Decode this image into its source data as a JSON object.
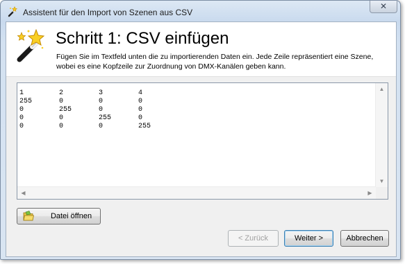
{
  "window": {
    "title": "Assistent für den Import von Szenen aus CSV",
    "close_glyph": "✕"
  },
  "header": {
    "step_title": "Schritt 1: CSV einfügen",
    "description": "Fügen Sie im Textfeld unten die zu importierenden Daten ein. Jede Zeile repräsentiert eine Szene, wobei es eine Kopfzeile zur Zuordnung von DMX-Kanälen geben kann.",
    "icon": "magic-wand-icon"
  },
  "csv": {
    "rows": [
      [
        "1",
        "2",
        "3",
        "4"
      ],
      [
        "255",
        "0",
        "0",
        "0"
      ],
      [
        "0",
        "255",
        "0",
        "0"
      ],
      [
        "0",
        "0",
        "255",
        "0"
      ],
      [
        "0",
        "0",
        "0",
        "255"
      ]
    ]
  },
  "buttons": {
    "open_file": "Datei öffnen",
    "back": "< Zurück",
    "next": "Weiter >",
    "finish": "Abbrechen"
  },
  "colors": {
    "accent": "#3c7fb1",
    "title_bar": "#c9daee",
    "dialog_bg": "#f0f0f0"
  }
}
